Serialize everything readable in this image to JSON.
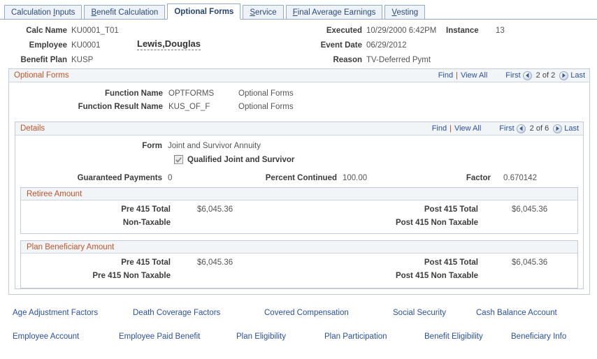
{
  "tabs": [
    {
      "label": "Calculation Inputs",
      "access_key": "I",
      "active": false
    },
    {
      "label": "Benefit Calculation",
      "access_key": "B",
      "active": false
    },
    {
      "label": "Optional Forms",
      "access_key": "",
      "active": true
    },
    {
      "label": "Service",
      "access_key": "S",
      "active": false
    },
    {
      "label": "Final Average Earnings",
      "access_key": "F",
      "active": false
    },
    {
      "label": "Vesting",
      "access_key": "V",
      "active": false
    }
  ],
  "header": {
    "calc_name_label": "Calc Name",
    "calc_name_value": "KU0001_T01",
    "employee_label": "Employee",
    "employee_value": "KU0001",
    "employee_name": "Lewis,Douglas",
    "benefit_plan_label": "Benefit Plan",
    "benefit_plan_value": "KUSP",
    "executed_label": "Executed",
    "executed_value": "10/29/2000 6:42PM",
    "instance_label": "Instance",
    "instance_value": "13",
    "event_date_label": "Event Date",
    "event_date_value": "06/29/2012",
    "reason_label": "Reason",
    "reason_value": "TV-Deferred Pymt"
  },
  "optional_forms": {
    "title": "Optional Forms",
    "find_label": "Find",
    "view_all_label": "View All",
    "first_label": "First",
    "last_label": "Last",
    "sequence": "2 of 2",
    "function_name_label": "Function Name",
    "function_name_value": "OPTFORMS",
    "function_name_xlat": "Optional Forms",
    "function_result_name_label": "Function Result Name",
    "function_result_name_value": "KUS_OF_F",
    "function_result_name_xlat": "Optional Forms"
  },
  "details": {
    "title": "Details",
    "find_label": "Find",
    "view_all_label": "View All",
    "first_label": "First",
    "last_label": "Last",
    "sequence": "2 of 6",
    "form_label": "Form",
    "form_value": "Joint and Survivor Annuity",
    "qualified_checkbox_label": "Qualified Joint and Survivor",
    "qualified_checkbox_checked": true,
    "guaranteed_payments_label": "Guaranteed Payments",
    "guaranteed_payments_value": "0",
    "percent_continued_label": "Percent Continued",
    "percent_continued_value": "100.00",
    "factor_label": "Factor",
    "factor_value": "0.670142"
  },
  "retiree_amount": {
    "title": "Retiree Amount",
    "pre_415_total_label": "Pre 415 Total",
    "pre_415_total_value": "$6,045.36",
    "post_415_total_label": "Post 415 Total",
    "post_415_total_value": "$6,045.36",
    "non_taxable_label": "Non-Taxable",
    "non_taxable_value": "",
    "post_415_non_taxable_label": "Post 415 Non Taxable",
    "post_415_non_taxable_value": ""
  },
  "plan_beneficiary_amount": {
    "title": "Plan Beneficiary Amount",
    "pre_415_total_label": "Pre 415 Total",
    "pre_415_total_value": "$6,045.36",
    "post_415_total_label": "Post 415 Total",
    "post_415_total_value": "$6,045.36",
    "pre_415_non_taxable_label": "Pre 415 Non Taxable",
    "pre_415_non_taxable_value": "",
    "post_415_non_taxable_label": "Post 415 Non Taxable",
    "post_415_non_taxable_value": ""
  },
  "bottom_links": {
    "row1": [
      "Age Adjustment Factors",
      "Death Coverage Factors",
      "Covered Compensation",
      "Social Security",
      "Cash Balance Account"
    ],
    "row2": [
      "Employee Account",
      "Employee Paid Benefit",
      "Plan Eligibility",
      "Plan Participation",
      "Benefit Eligibility",
      "Beneficiary Info"
    ]
  },
  "colors": {
    "group_title": "#c0542a",
    "link": "#2b50a0",
    "tab_border": "#93aacb",
    "panel_border": "#c3ccd6"
  }
}
